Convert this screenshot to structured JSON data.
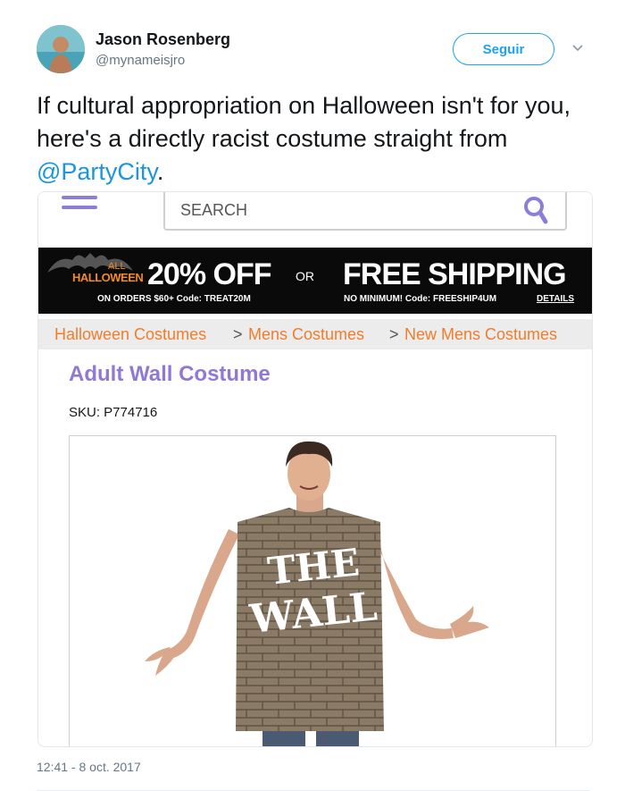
{
  "tweet": {
    "author_name": "Jason Rosenberg",
    "author_handle": "@mynameisjro",
    "follow_label": "Seguir",
    "text_before": "If cultural appropriation on Halloween isn't for you, here's a directly racist costume straight from ",
    "mention": "@PartyCity",
    "text_after": ".",
    "timestamp": "12:41 - 8 oct. 2017"
  },
  "screenshot": {
    "search_placeholder": "SEARCH",
    "promo": {
      "all": "ALL",
      "halloween": "HALLOWEEN",
      "discount": "20% OFF",
      "or": "OR",
      "free_shipping": "FREE SHIPPING",
      "discount_terms": "ON ORDERS $60+  Code: TREAT20M",
      "shipping_terms": "NO MINIMUM!  Code: FREESHIP4UM",
      "details": "DETAILS"
    },
    "breadcrumbs": [
      "Halloween Costumes",
      "Mens Costumes",
      "New Mens Costumes"
    ],
    "breadcrumb_sep": ">",
    "product_title": "Adult Wall Costume",
    "sku": "SKU: P774716",
    "costume_text_line1": "THE",
    "costume_text_line2": "WALL"
  },
  "colors": {
    "twitter_blue": "#1da1f2",
    "partycity_purple": "#9178d6",
    "breadcrumb_orange": "#f07d2c"
  }
}
